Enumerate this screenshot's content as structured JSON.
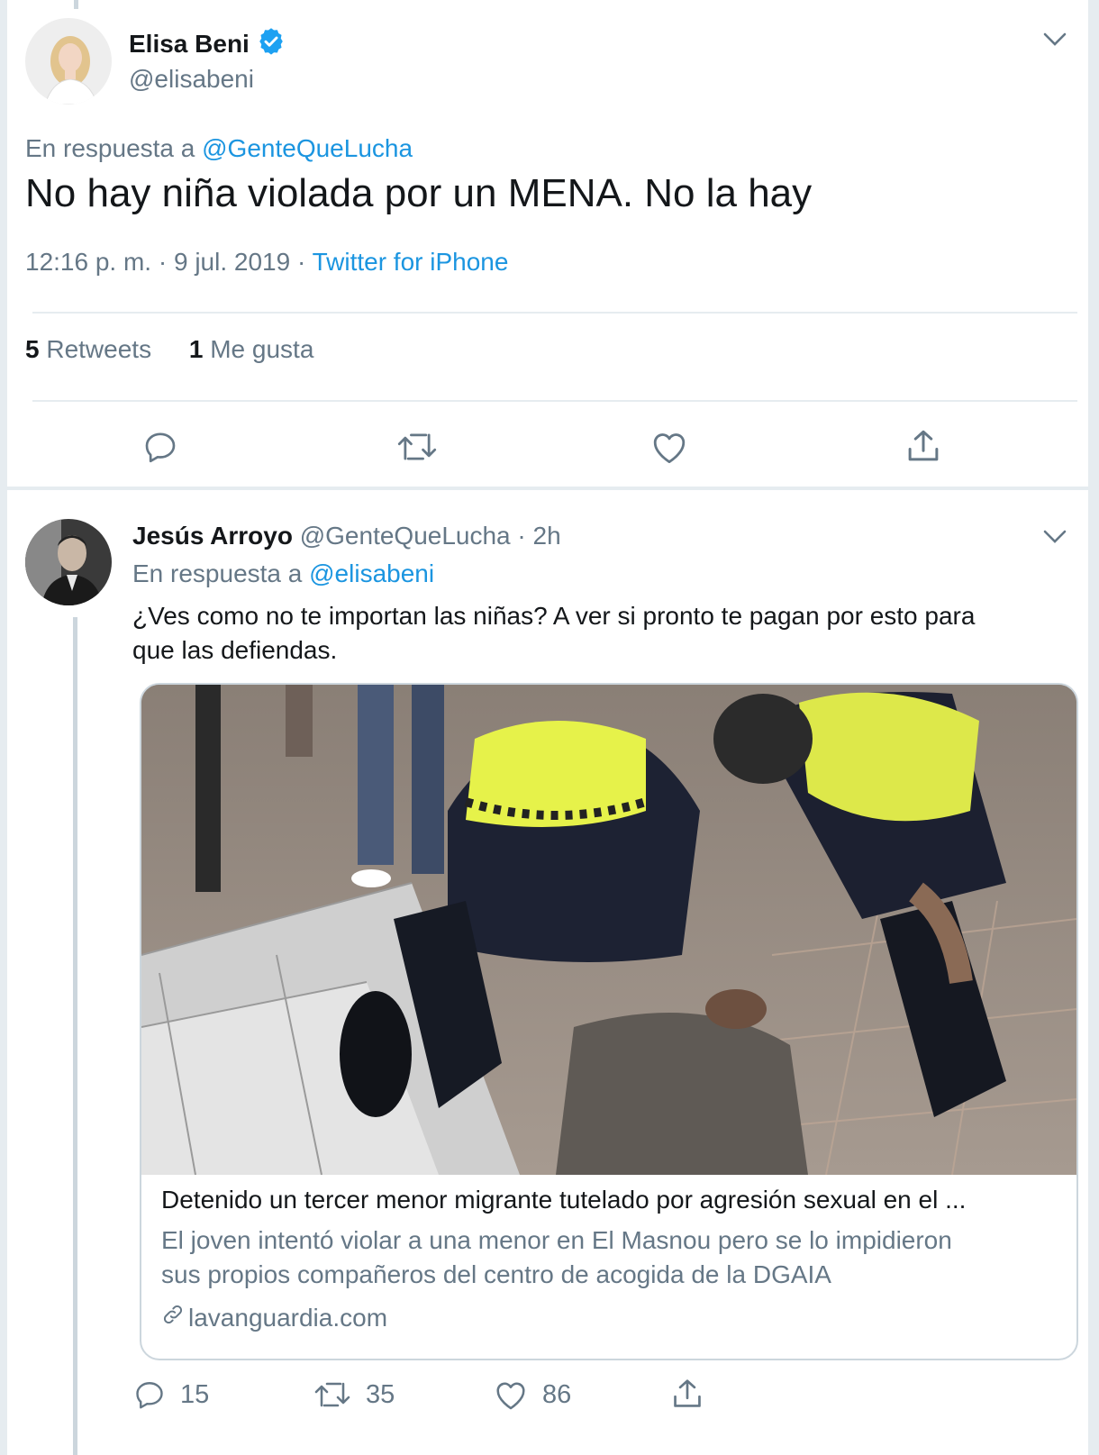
{
  "main_tweet": {
    "author_name": "Elisa Beni",
    "author_handle": "@elisabeni",
    "reply_prefix": "En respuesta a",
    "reply_to": "@GenteQueLucha",
    "text": "No hay niña violada por un MENA. No la hay",
    "timestamp": "12:16 p. m. · 9 jul. 2019 ·",
    "source": "Twitter for iPhone",
    "retweets_count": "5",
    "retweets_label": "Retweets",
    "likes_count": "1",
    "likes_label": "Me gusta"
  },
  "reply_tweet": {
    "author_name": "Jesús Arroyo",
    "author_handle": "@GenteQueLucha",
    "time": "· 2h",
    "reply_prefix": "En respuesta a",
    "reply_to": "@elisabeni",
    "text_line1": "¿Ves como no te importan las niñas? A ver si pronto te pagan por esto para",
    "text_line2": "que las defiendas.",
    "card": {
      "title": "Detenido un tercer menor migrante tutelado por agresión sexual en el ...",
      "desc_line1": "El joven intentó violar a una menor en El Masnou pero se lo impidieron",
      "desc_line2": "sus propios compañeros del centro de acogida de la DGAIA",
      "domain": "lavanguardia.com"
    },
    "replies_count": "15",
    "retweets_count": "35",
    "likes_count": "86"
  },
  "colors": {
    "accent": "#1b95e0",
    "verified": "#1da1f2",
    "muted_text": "#657786",
    "divider": "#e6ecf0"
  },
  "icons": [
    "verified-badge-icon",
    "chevron-down-icon",
    "reply-icon",
    "retweet-icon",
    "like-icon",
    "share-icon",
    "link-icon"
  ]
}
